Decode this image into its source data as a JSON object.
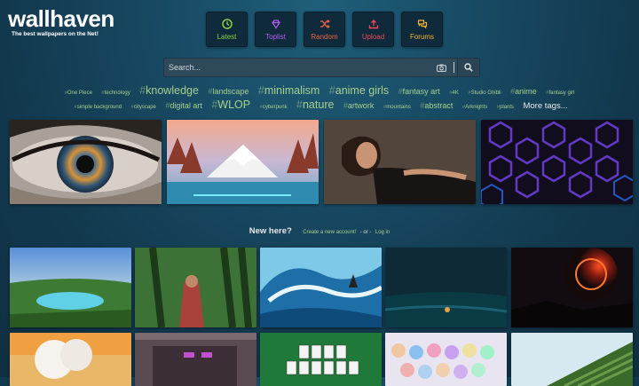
{
  "logo": {
    "title": "wallhaven",
    "tagline": "The best wallpapers on the Net!"
  },
  "nav": [
    {
      "label": "Latest",
      "color": "#8bd13f",
      "icon": "clock-icon"
    },
    {
      "label": "Toplist",
      "color": "#b15cf4",
      "icon": "diamond-icon"
    },
    {
      "label": "Random",
      "color": "#f06446",
      "icon": "shuffle-icon"
    },
    {
      "label": "Upload",
      "color": "#f0485a",
      "icon": "upload-icon"
    },
    {
      "label": "Forums",
      "color": "#f2b53a",
      "icon": "chat-icon"
    }
  ],
  "search": {
    "placeholder": "Search..."
  },
  "tags": {
    "row1": [
      "One Piece",
      "technology",
      "knowledge",
      "landscape",
      "minimalism",
      "anime girls",
      "fantasy art",
      "4K",
      "Studio Ghibli",
      "anime",
      "fantasy girl"
    ],
    "row2": [
      "simple background",
      "cityscape",
      "digital art",
      "WLOP",
      "cyberpunk",
      "nature",
      "artwork",
      "mountains",
      "abstract",
      "Arknights",
      "plants"
    ],
    "more": "More tags..."
  },
  "featured": [
    "eye close-up",
    "mountain landscape",
    "woman portrait",
    "hexagon pattern"
  ],
  "new_here": {
    "question": "New here?",
    "create": "Create a new account!",
    "or": "- or -",
    "login": "Log in"
  },
  "grid": [
    "crater lake",
    "forest warrior",
    "ocean wave",
    "dark seascape",
    "red eclipse",
    "white tree",
    "pixel building",
    "solitaire cards",
    "anime collage",
    "stairs"
  ],
  "colors": {
    "tag": "#a8d08d",
    "nav_bg": "#0f2a3a"
  }
}
